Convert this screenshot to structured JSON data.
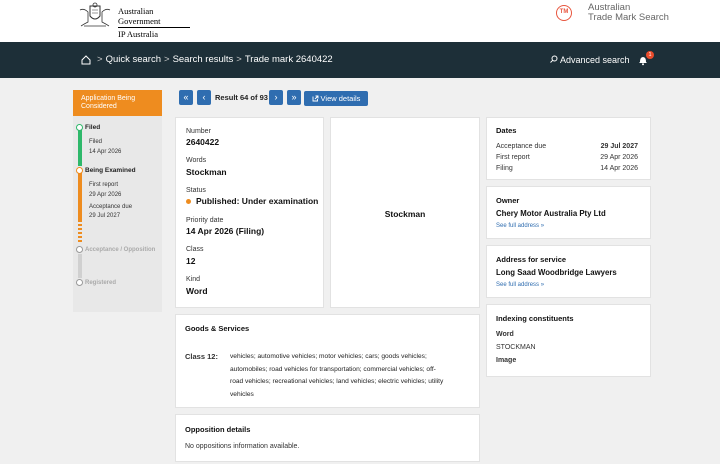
{
  "header": {
    "gov_line1": "Australian Government",
    "gov_line2": "IP Australia",
    "tm_badge": "TM",
    "tm_line1": "Australian",
    "tm_line2": "Trade Mark Search",
    "brand_color": "#e8563f"
  },
  "nav": {
    "home_icon": "home-icon",
    "crumbs": [
      "Quick search",
      "Search results",
      "Trade mark 2640422"
    ],
    "separator": ">",
    "advanced_search": "Advanced search",
    "notification_count": "1",
    "bar_color": "#1d2f38"
  },
  "sidebar": {
    "status_header": "Application Being Considered",
    "accent_color": "#ee8c1f",
    "filed_label": "Filed",
    "filed_sub_label": "Filed",
    "filed_sub_date": "14 Apr 2026",
    "examined_label": "Being Examined",
    "first_report_label": "First report",
    "first_report_date": "29 Apr 2026",
    "acceptance_due_label": "Acceptance due",
    "acceptance_due_date": "29 Jul 2027",
    "acceptance_opposition_label": "Acceptance / Opposition",
    "registered_label": "Registered"
  },
  "pagination": {
    "first": "«",
    "prev": "‹",
    "result_text": "Result 64 of 93",
    "next": "›",
    "last": "»",
    "view_details": "View details"
  },
  "details": {
    "number_label": "Number",
    "number_value": "2640422",
    "words_label": "Words",
    "words_value": "Stockman",
    "status_label": "Status",
    "status_value": "Published: Under examination",
    "priority_label": "Priority date",
    "priority_value": "14 Apr 2026 (Filing)",
    "class_label": "Class",
    "class_value": "12",
    "kind_label": "Kind",
    "kind_value": "Word"
  },
  "preview": {
    "text": "Stockman"
  },
  "dates": {
    "title": "Dates",
    "rows": [
      {
        "label": "Acceptance due",
        "value": "29 Jul 2027"
      },
      {
        "label": "First report",
        "value": "29 Apr 2026"
      },
      {
        "label": "Filing",
        "value": "14 Apr 2026"
      }
    ]
  },
  "owner": {
    "title": "Owner",
    "name": "Chery Motor Australia Pty Ltd",
    "link": "See full address »"
  },
  "service": {
    "title": "Address for service",
    "name": "Long Saad Woodbridge Lawyers",
    "link": "See full address »"
  },
  "indexing": {
    "title": "Indexing constituents",
    "word_label": "Word",
    "word_value": "STOCKMAN",
    "image_label": "Image"
  },
  "goods": {
    "title": "Goods & Services",
    "class_label": "Class 12:",
    "lines": [
      "vehicles; automotive vehicles; motor vehicles; cars; goods vehicles;",
      "automobiles; road vehicles for transportation; commercial vehicles; off-",
      "road vehicles; recreational vehicles; land vehicles; electric vehicles; utility",
      "vehicles"
    ]
  },
  "opposition": {
    "title": "Opposition details",
    "text": "No oppositions information available."
  }
}
